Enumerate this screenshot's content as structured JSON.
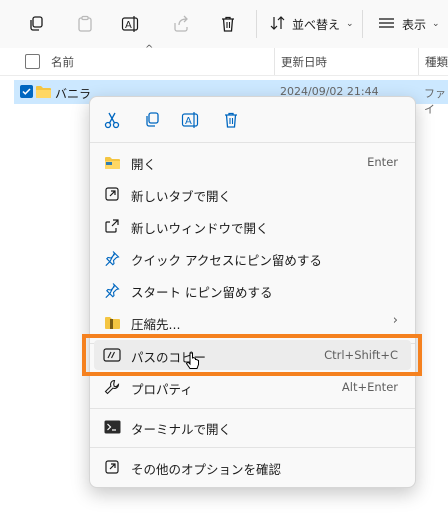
{
  "toolbar": {
    "sort_label": "並べ替え",
    "view_label": "表示",
    "icons": [
      "copy-icon",
      "paste-icon",
      "rename-icon",
      "share-icon",
      "delete-icon",
      "sort-icon",
      "view-icon"
    ]
  },
  "columns": {
    "name": "名前",
    "modified": "更新日時",
    "type": "種類"
  },
  "row": {
    "name": "バニラ",
    "modified": "2024/09/02 21:44",
    "type": "ファイ"
  },
  "context_menu": {
    "quick_actions": [
      "cut-icon",
      "copy-icon",
      "rename-icon",
      "delete-icon"
    ],
    "items": [
      {
        "label": "開く",
        "shortcut": "Enter",
        "icon": "folder-icon"
      },
      {
        "label": "新しいタブで開く",
        "shortcut": "",
        "icon": "new-tab-icon"
      },
      {
        "label": "新しいウィンドウで開く",
        "shortcut": "",
        "icon": "new-window-icon"
      },
      {
        "label": "クイック アクセスにピン留めする",
        "shortcut": "",
        "icon": "pin-icon"
      },
      {
        "label": "スタート にピン留めする",
        "shortcut": "",
        "icon": "pin-icon"
      },
      {
        "label": "圧縮先...",
        "shortcut": "",
        "icon": "zip-icon"
      },
      {
        "label": "パスのコピー",
        "shortcut": "Ctrl+Shift+C",
        "icon": "copy-path-icon"
      },
      {
        "label": "プロパティ",
        "shortcut": "Alt+Enter",
        "icon": "wrench-icon"
      },
      {
        "label": "ターミナルで開く",
        "shortcut": "",
        "icon": "terminal-icon"
      },
      {
        "label": "その他のオプションを確認",
        "shortcut": "",
        "icon": "more-options-icon"
      }
    ]
  },
  "colors": {
    "accent": "#0067c0",
    "highlight": "#f5811f",
    "selected_row": "#cce8ff"
  }
}
